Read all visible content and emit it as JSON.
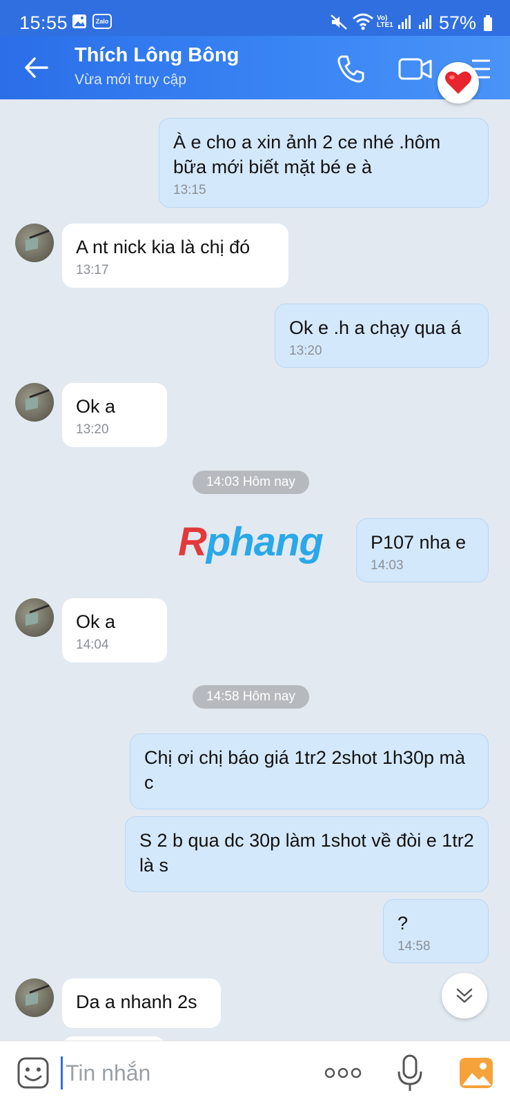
{
  "status_bar": {
    "time": "15:55",
    "battery": "57%",
    "icons": [
      "gallery-icon",
      "zalo-icon",
      "mute-icon",
      "wifi-icon",
      "volte-icon",
      "signal-icon",
      "signal-icon",
      "battery-icon"
    ],
    "zalo_label": "Zalo",
    "volte_label": "Vo) LTE1"
  },
  "header": {
    "contact_name": "Thích Lông Bông",
    "contact_status": "Vừa mới truy cập",
    "actions": [
      "back-icon",
      "phone-icon",
      "video-icon",
      "menu-icon"
    ]
  },
  "messages": [
    {
      "side": "out",
      "text": "À e cho a xin ảnh 2 ce nhé .hôm bữa mới biết mặt bé e à",
      "time": "13:15"
    },
    {
      "side": "in",
      "text": "A nt nick kia là chị đó",
      "time": "13:17"
    },
    {
      "side": "out",
      "text": "Ok e .h a chạy qua á",
      "time": "13:20"
    },
    {
      "side": "in",
      "text": "Ok a",
      "time": "13:20"
    },
    {
      "side": "divider",
      "text": "14:03 Hôm nay"
    },
    {
      "side": "out",
      "text": "P107 nha e",
      "time": "14:03"
    },
    {
      "side": "in",
      "text": "Ok a",
      "time": "14:04"
    },
    {
      "side": "divider",
      "text": "14:58 Hôm nay"
    },
    {
      "side": "out",
      "text": "Chị ơi chị báo giá 1tr2 2shot 1h30p mà c",
      "time": ""
    },
    {
      "side": "out",
      "text": "S 2 b qua dc 30p làm 1shot về đòi e 1tr2 là s",
      "time": ""
    },
    {
      "side": "out",
      "text": "?",
      "time": "14:58"
    },
    {
      "side": "in",
      "text": "Da a nhanh 2s",
      "time": ""
    }
  ],
  "watermark": {
    "first": "R",
    "rest": "phang"
  },
  "input": {
    "placeholder": "Tin nhắn",
    "value": ""
  },
  "colors": {
    "header": "#2f6fe0",
    "outgoing_bubble": "#d4e8fb",
    "incoming_bubble": "#ffffff",
    "background": "#e2e9f1"
  }
}
